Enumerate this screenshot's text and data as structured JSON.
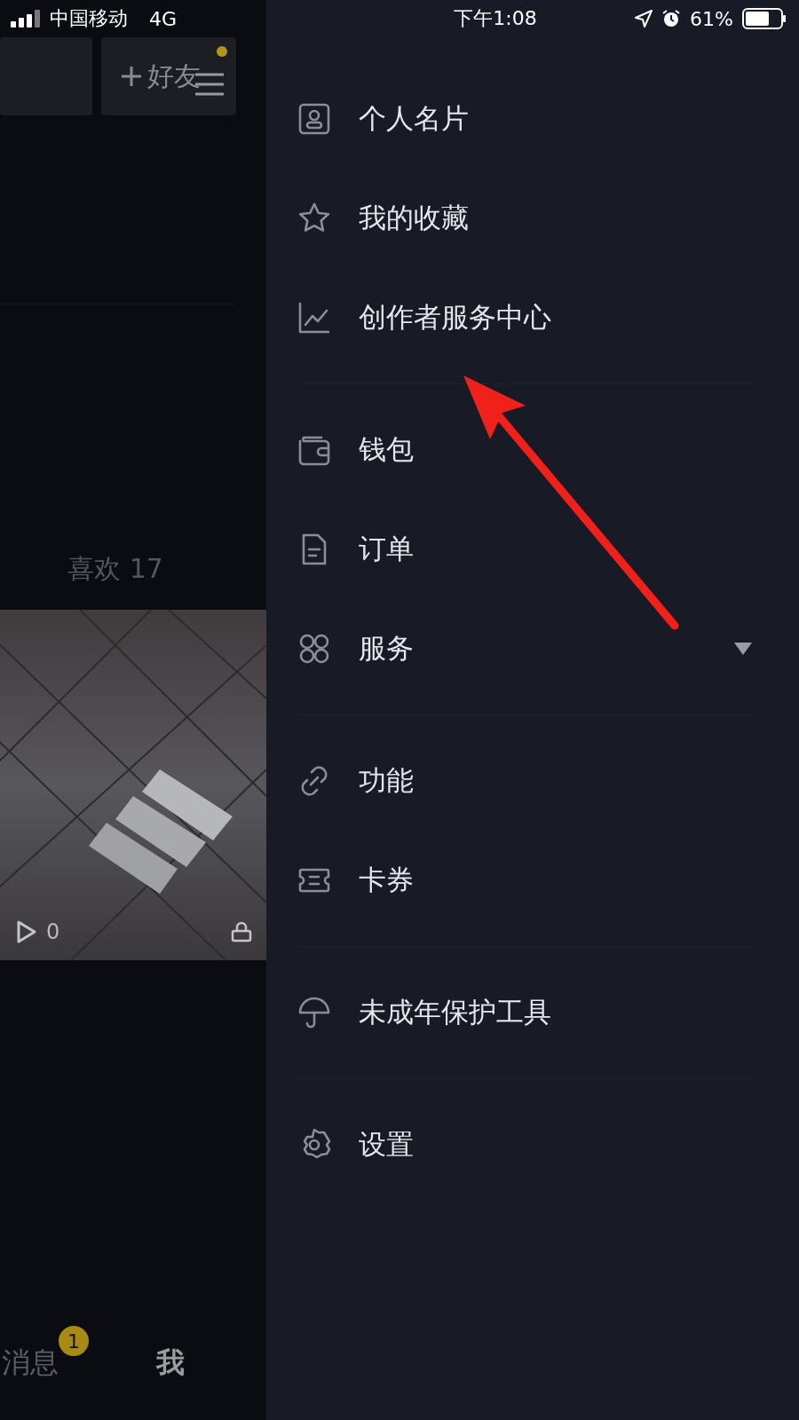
{
  "status_bar": {
    "carrier": "中国移动",
    "network": "4G",
    "time": "下午1:08",
    "battery": "61%"
  },
  "profile": {
    "add_friend": "好友",
    "has_notice": true,
    "likes_tab": "喜欢 17",
    "videos": [
      {
        "kind": "picture",
        "plays": "0",
        "locked": true
      }
    ]
  },
  "bottom_tabs": [
    {
      "label": "消息",
      "badge": "1",
      "selected": false
    },
    {
      "label": "我",
      "selected": true
    }
  ],
  "menu": {
    "groups": [
      {
        "items": [
          {
            "label": "个人名片"
          },
          {
            "label": "我的收藏"
          },
          {
            "label": "创作者服务中心"
          }
        ]
      },
      {
        "items": [
          {
            "label": "钱包"
          },
          {
            "label": "订单"
          },
          {
            "label": "服务",
            "expanded": false
          }
        ]
      },
      {
        "items": [
          {
            "label": "功能"
          },
          {
            "label": "卡券"
          }
        ]
      },
      {
        "items": [
          {
            "label": "未成年保护工具"
          }
        ]
      },
      {
        "items": [
          {
            "label": "设置"
          }
        ]
      }
    ]
  }
}
